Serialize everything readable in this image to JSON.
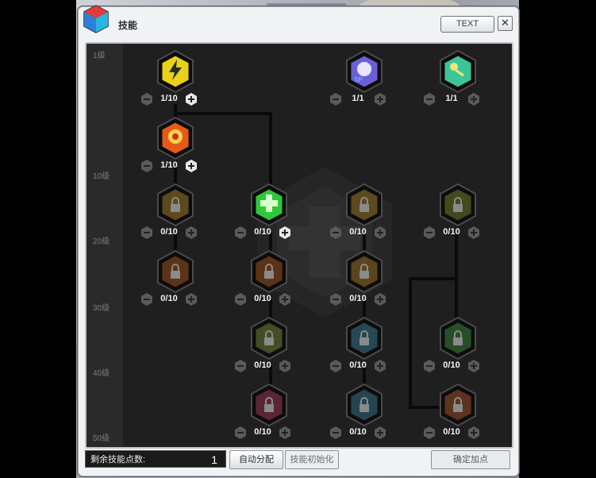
{
  "window": {
    "title": "技能",
    "text_button": "TEXT",
    "close_symbol": "✕"
  },
  "levels": [
    "1级",
    "10级",
    "20级",
    "30级",
    "40级",
    "50级"
  ],
  "skills": [
    {
      "id": "s1",
      "count": "1/10",
      "state": "unlocked",
      "color": "#e8d21a",
      "icon": "lightning-skill-icon",
      "plus": true
    },
    {
      "id": "s2",
      "count": "1/1",
      "state": "unlocked",
      "color": "#6b5fd8",
      "icon": "sp-skill-icon",
      "plus": false
    },
    {
      "id": "s3",
      "count": "1/1",
      "state": "unlocked",
      "color": "#3cc49a",
      "icon": "key-skill-icon",
      "plus": false
    },
    {
      "id": "s4",
      "count": "1/10",
      "state": "unlocked",
      "color": "#e55a1a",
      "icon": "burst-skill-icon",
      "plus": true
    },
    {
      "id": "s5",
      "count": "0/10",
      "state": "locked",
      "color": "#6b5520",
      "icon": "lock-icon",
      "plus": false
    },
    {
      "id": "s6",
      "count": "0/10",
      "state": "unlocked",
      "color": "#2ec83a",
      "icon": "heal-skill-icon",
      "plus": true
    },
    {
      "id": "s7",
      "count": "0/10",
      "state": "locked",
      "color": "#6b5520",
      "icon": "lock-icon",
      "plus": false
    },
    {
      "id": "s8",
      "count": "0/10",
      "state": "locked",
      "color": "#4c5520",
      "icon": "lock-icon",
      "plus": false
    },
    {
      "id": "s9",
      "count": "0/10",
      "state": "locked",
      "color": "#6b3a18",
      "icon": "lock-icon",
      "plus": false
    },
    {
      "id": "s10",
      "count": "0/10",
      "state": "locked",
      "color": "#6b3a18",
      "icon": "lock-icon",
      "plus": false
    },
    {
      "id": "s11",
      "count": "0/10",
      "state": "locked",
      "color": "#6b5020",
      "icon": "lock-icon",
      "plus": false
    },
    {
      "id": "s12",
      "count": "0/10",
      "state": "locked",
      "color": "#4c5a28",
      "icon": "lock-icon",
      "plus": false
    },
    {
      "id": "s13",
      "count": "0/10",
      "state": "locked",
      "color": "#2a5560",
      "icon": "lock-icon",
      "plus": false
    },
    {
      "id": "s14",
      "count": "0/10",
      "state": "locked",
      "color": "#2d5a2d",
      "icon": "lock-icon",
      "plus": false
    },
    {
      "id": "s15",
      "count": "0/10",
      "state": "locked",
      "color": "#6a2a3a",
      "icon": "lock-icon",
      "plus": false
    },
    {
      "id": "s16",
      "count": "0/10",
      "state": "locked",
      "color": "#2a4f5a",
      "icon": "lock-icon",
      "plus": false
    },
    {
      "id": "s17",
      "count": "0/10",
      "state": "locked",
      "color": "#6b3a20",
      "icon": "lock-icon",
      "plus": false
    }
  ],
  "footer": {
    "points_label": "剩余技能点数:",
    "points_value": "1",
    "auto_button": "自动分配",
    "reset_button": "技能初始化",
    "confirm_button": "确定加点"
  }
}
